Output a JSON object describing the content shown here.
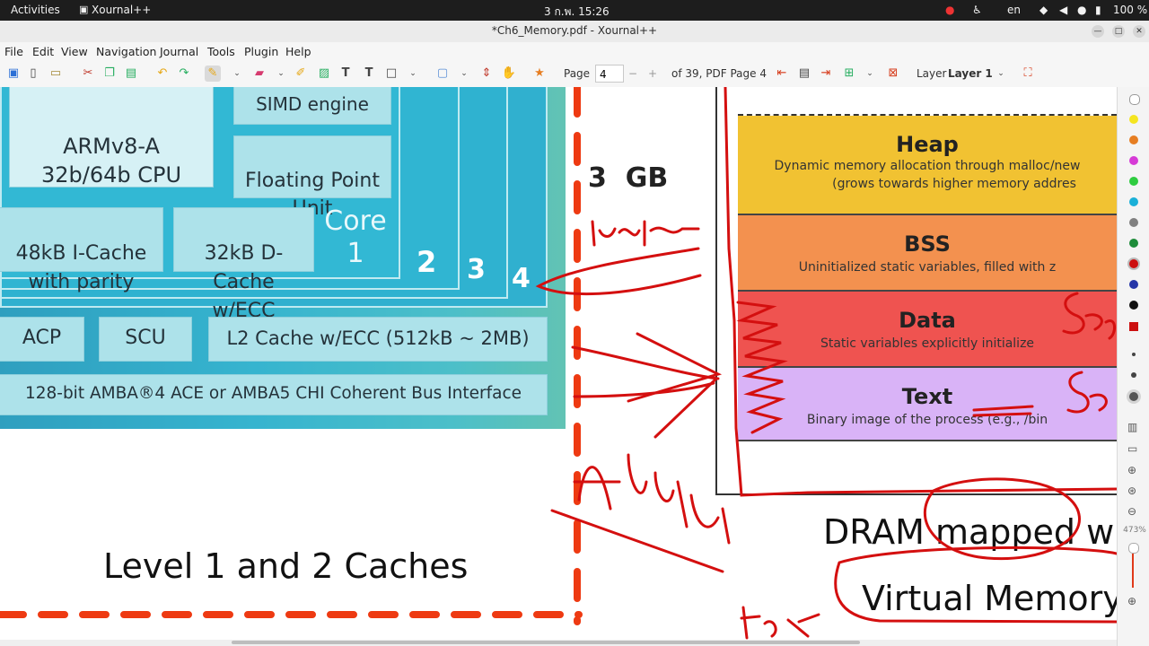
{
  "topbar": {
    "activities": "Activities",
    "app_name": "Xournal++",
    "clock": "3 ก.พ.  15:26",
    "lang": "en",
    "battery": "100 %"
  },
  "window": {
    "title": "*Ch6_Memory.pdf - Xournal++"
  },
  "menu": [
    "File",
    "Edit",
    "View",
    "Navigation",
    "Journal",
    "Tools",
    "Plugin",
    "Help"
  ],
  "toolbar": {
    "page_label": "Page",
    "page_value": "4",
    "page_of": "of 39, PDF Page 4",
    "layer_label": "Layer",
    "layer_value": "Layer 1",
    "minus": "−",
    "plus": "+"
  },
  "zoom": {
    "value": "473%"
  },
  "colors": {
    "palette": [
      "#ffffff",
      "#f5e520",
      "#e67e22",
      "#d63bd6",
      "#2ecc40",
      "#1ab0d8",
      "#808080",
      "#1e8c3a",
      "#cc1010",
      "#2536a8",
      "#111111",
      "#cc1010"
    ],
    "ink": "#d40f0f",
    "teal": "#3cc0d5",
    "heap": "#f1c232",
    "bss": "#f3914f",
    "data": "#ef5350",
    "text_seg": "#d9b3f7"
  },
  "diagram": {
    "cpu": "ARMv8-A\n32b/64b CPU",
    "simd": "SIMD engine",
    "fpu": "Floating Point\nUnit",
    "icache": "48kB I-Cache\nwith parity",
    "dcache": "32kB D-Cache\nw/ECC",
    "core": "Core\n1",
    "core2": "2",
    "core3": "3",
    "core4": "4",
    "acp": "ACP",
    "scu": "SCU",
    "l2": "L2 Cache w/ECC (512kB ~ 2MB)",
    "bus": "128-bit AMBA®4 ACE or AMBA5 CHI Coherent Bus Interface",
    "caption": "Level 1 and 2 Caches"
  },
  "memory": {
    "size_label": "3  GB",
    "segments": [
      {
        "name": "Heap",
        "desc": "Dynamic memory allocation through malloc/new",
        "desc2": "(grows towards higher memory addres"
      },
      {
        "name": "BSS",
        "desc": "Uninitialized static variables, filled with z"
      },
      {
        "name": "Data",
        "desc": "Static variables explicitly initialize"
      },
      {
        "name": "Text",
        "desc": "Binary image of the process (e.g., /bin"
      }
    ],
    "caption1": "DRAM mapped w",
    "caption2": "Virtual Memory"
  },
  "ink_notes": {
    "instruction": "instruc",
    "address": "Address",
    "seg1": "Seg",
    "seg2": "Seg",
    "for": "for"
  }
}
